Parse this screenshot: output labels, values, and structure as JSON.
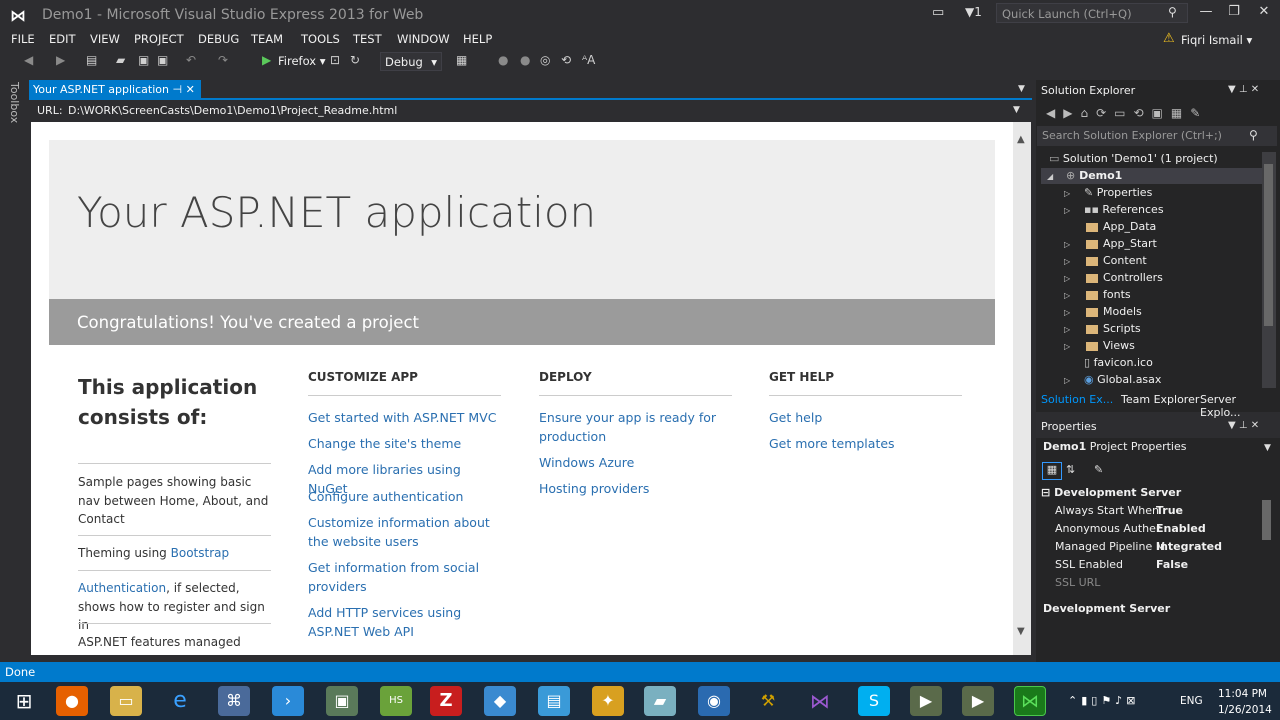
{
  "window": {
    "title": "Demo1 - Microsoft Visual Studio Express 2013 for Web",
    "flag_count": "1",
    "quick_launch_placeholder": "Quick Launch (Ctrl+Q)",
    "user": "Fiqri Ismail"
  },
  "menu": [
    "FILE",
    "EDIT",
    "VIEW",
    "PROJECT",
    "DEBUG",
    "TEAM",
    "TOOLS",
    "TEST",
    "WINDOW",
    "HELP"
  ],
  "toolbar": {
    "run_target": "Firefox",
    "configuration": "Debug"
  },
  "left_strip": {
    "toolbox_label": "Toolbox"
  },
  "document": {
    "tab_label": "Your ASP.NET application",
    "url_label": "URL:",
    "url_value": "D:\\WORK\\ScreenCasts\\Demo1\\Demo1\\Project_Readme.html"
  },
  "page": {
    "title": "Your ASP.NET application",
    "congrats": "Congratulations! You've created a project",
    "consists": "This application consists of:",
    "left_items": [
      "Sample pages showing basic nav between Home, About, and Contact",
      "Theming using",
      "Bootstrap",
      "Authentication",
      ", if selected, shows how to register and sign in",
      "ASP.NET features managed using"
    ],
    "columns": [
      {
        "heading": "CUSTOMIZE APP",
        "links": [
          "Get started with ASP.NET MVC",
          "Change the site's theme",
          "Add more libraries using NuGet",
          "Configure authentication",
          "Customize information about the website users",
          "Get information from social providers",
          "Add HTTP services using ASP.NET Web API"
        ]
      },
      {
        "heading": "DEPLOY",
        "links": [
          "Ensure your app is ready for production",
          "Windows Azure",
          "Hosting providers"
        ]
      },
      {
        "heading": "GET HELP",
        "links": [
          "Get help",
          "Get more templates"
        ]
      }
    ]
  },
  "solution_explorer": {
    "title": "Solution Explorer",
    "search_placeholder": "Search Solution Explorer (Ctrl+;)",
    "solution": "Solution 'Demo1' (1 project)",
    "project": "Demo1",
    "items": [
      "Properties",
      "References",
      "App_Data",
      "App_Start",
      "Content",
      "Controllers",
      "fonts",
      "Models",
      "Scripts",
      "Views",
      "favicon.ico",
      "Global.asax"
    ],
    "tabs": [
      "Solution Ex...",
      "Team Explorer",
      "Server Explo..."
    ]
  },
  "properties": {
    "title": "Properties",
    "object": "Demo1",
    "object_type": "Project Properties",
    "category": "Development Server",
    "rows": [
      {
        "name": "Always Start When",
        "value": "True"
      },
      {
        "name": "Anonymous Auther",
        "value": "Enabled"
      },
      {
        "name": "Managed Pipeline M",
        "value": "Integrated"
      },
      {
        "name": "SSL Enabled",
        "value": "False"
      },
      {
        "name": "SSL URL",
        "value": ""
      }
    ],
    "description_title": "Development Server"
  },
  "status": {
    "text": "Done"
  },
  "tray": {
    "lang": "ENG",
    "time": "11:04 PM",
    "date": "1/26/2014"
  }
}
